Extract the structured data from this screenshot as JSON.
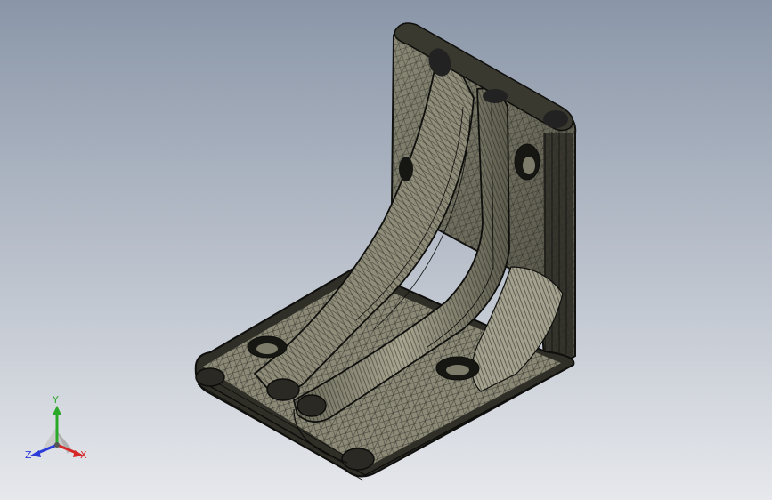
{
  "colors": {
    "background_top": "#8a96a8",
    "background_bottom": "#e6e8ec",
    "model_fill": "#b0ad9a",
    "model_shade": "#4a4a40",
    "wire": "#141410",
    "axis_x": "#d62828",
    "axis_y": "#29a829",
    "axis_z": "#2b3bd8"
  },
  "triad": {
    "x_label": "X",
    "y_label": "Y",
    "z_label": "Z",
    "icon": "reference-triad-icon"
  }
}
